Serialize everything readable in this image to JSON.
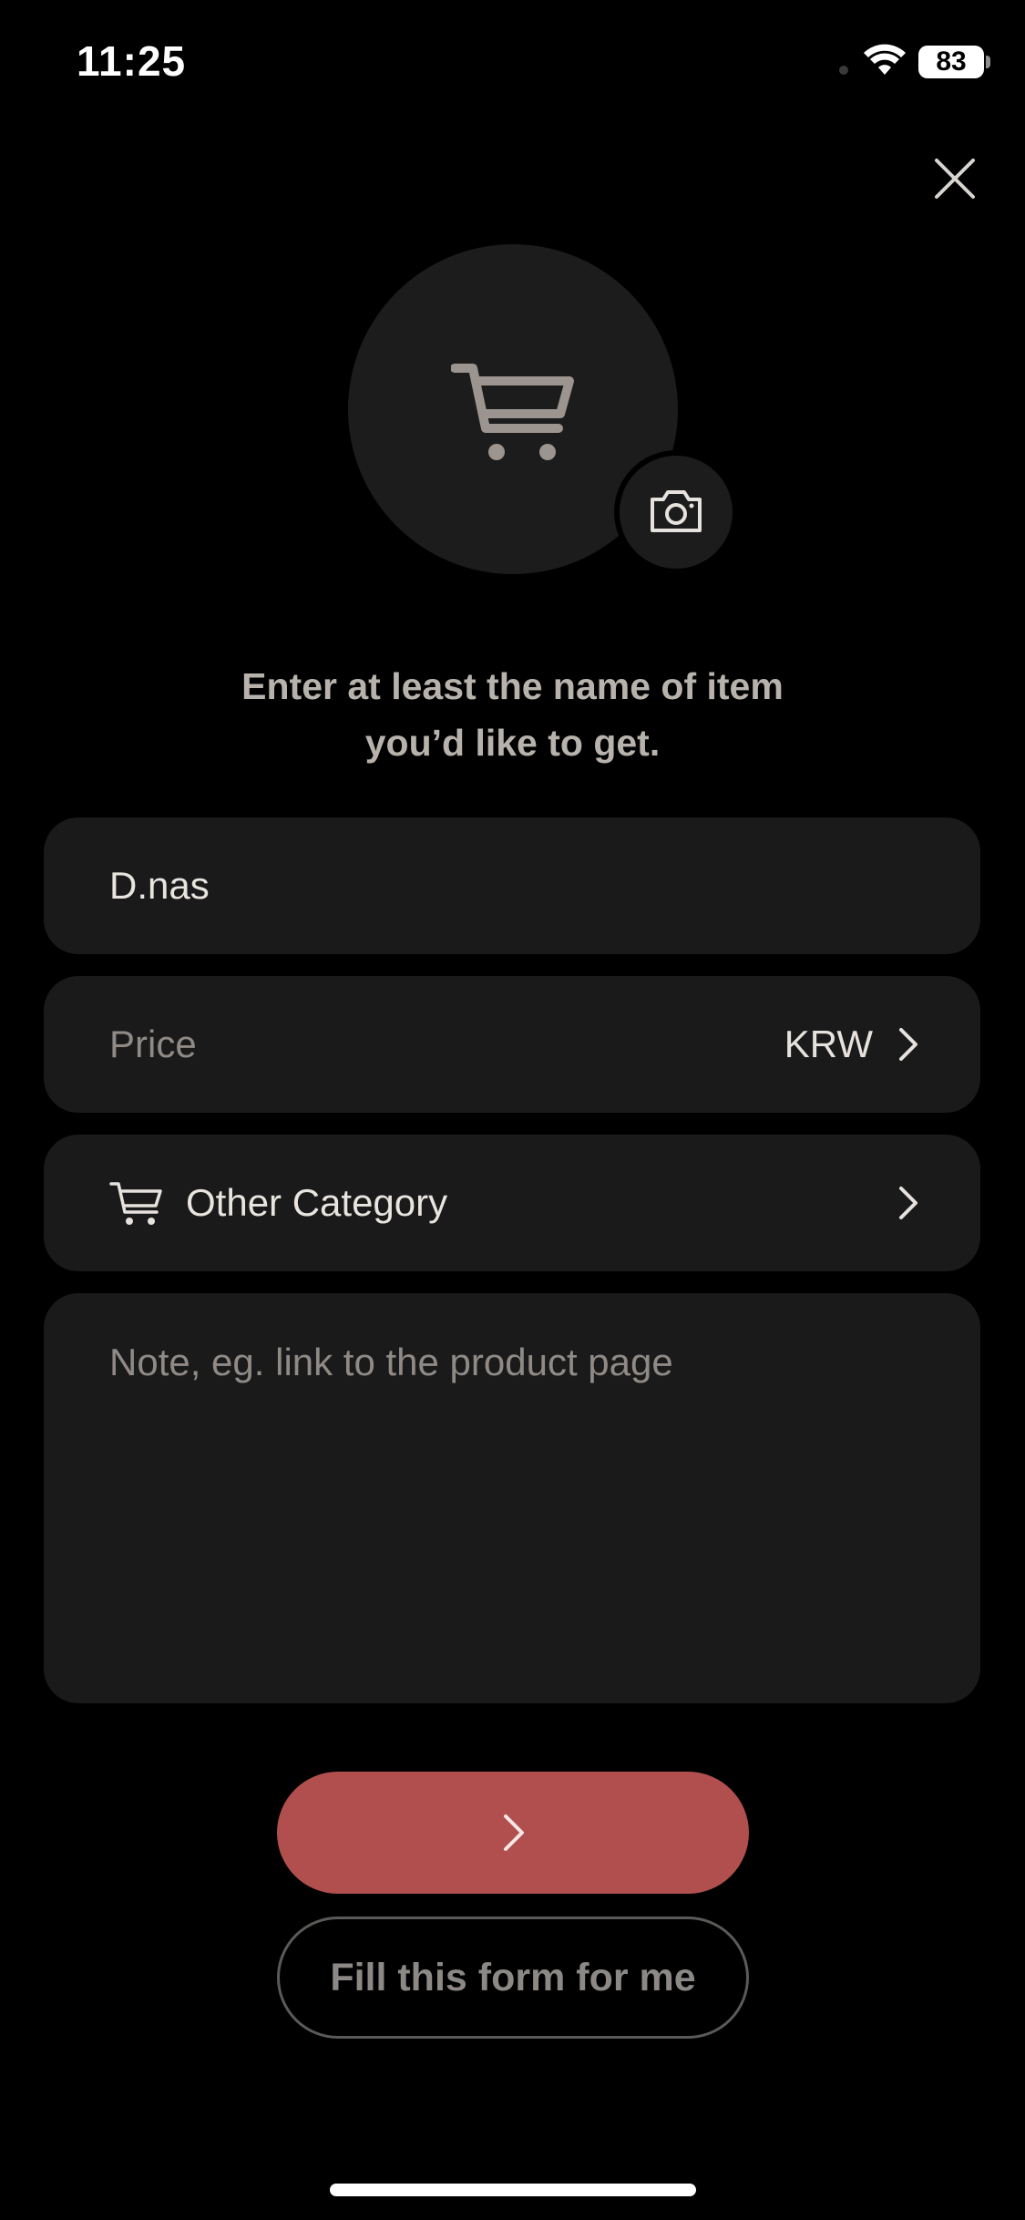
{
  "status_bar": {
    "time": "11:25",
    "battery": "83"
  },
  "header": {
    "close_icon": "close-icon"
  },
  "avatar": {
    "icon": "shopping-cart-icon",
    "camera_icon": "camera-icon"
  },
  "instruction": {
    "line1": "Enter at least the name of item",
    "line2": "you’d like to get."
  },
  "form": {
    "name_value": "D.nas",
    "price_placeholder": "Price",
    "currency": "KRW",
    "category_label": "Other Category",
    "category_icon": "shopping-cart-icon",
    "note_placeholder": "Note, eg. link to the product page"
  },
  "actions": {
    "next_icon": "chevron-right-icon",
    "fill_label": "Fill this form for me"
  },
  "colors": {
    "background": "#000000",
    "field": "#1a1a1a",
    "accent": "#b04f4e",
    "muted_text": "#8f8a86"
  }
}
